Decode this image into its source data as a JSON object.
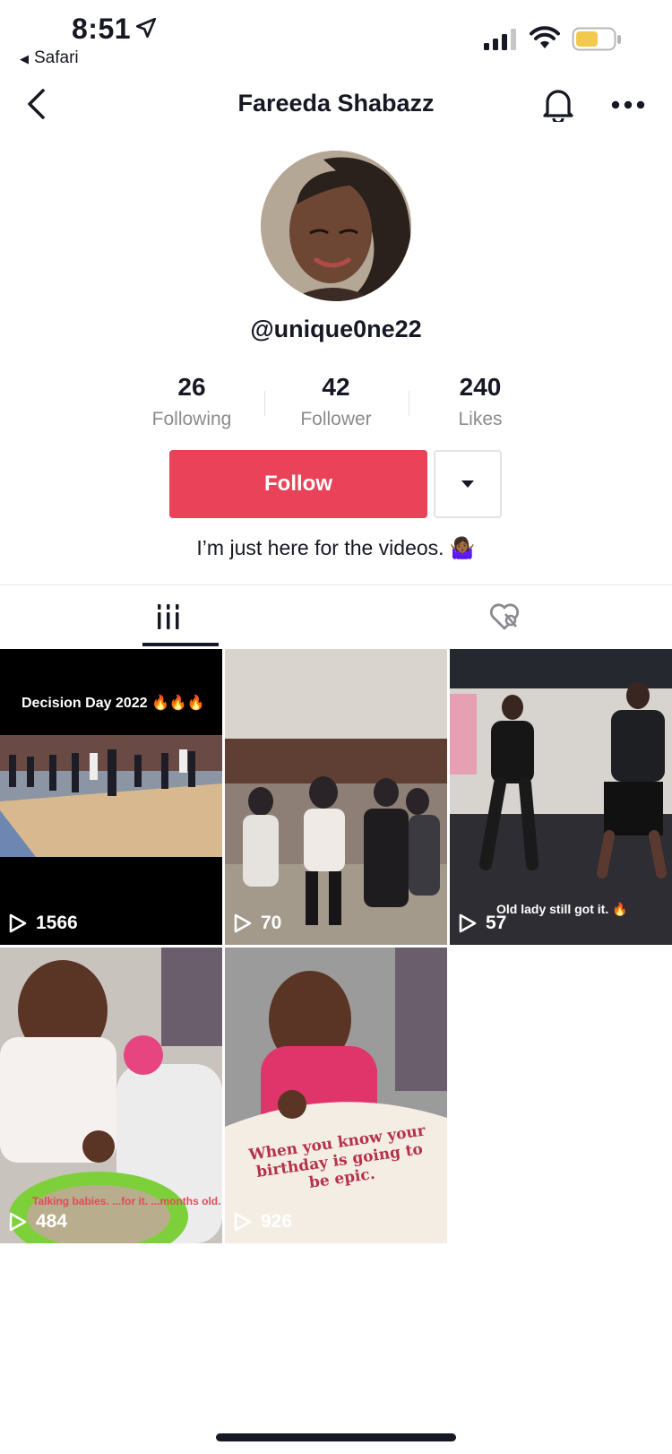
{
  "status_bar": {
    "time": "8:51",
    "back_app": "Safari"
  },
  "nav": {
    "title": "Fareeda Shabazz"
  },
  "profile": {
    "handle": "@unique0ne22",
    "bio": "I’m just here for the videos. 🤷🏾‍♀️"
  },
  "stats": [
    {
      "value": "26",
      "label": "Following"
    },
    {
      "value": "42",
      "label": "Follower"
    },
    {
      "value": "240",
      "label": "Likes"
    }
  ],
  "actions": {
    "follow_label": "Follow"
  },
  "tabs": [
    {
      "name": "videos-grid-tab",
      "icon": "grid-icon"
    },
    {
      "name": "liked-tab",
      "icon": "hidden-heart-icon"
    }
  ],
  "videos": [
    {
      "views": "1566",
      "caption": "Decision Day 2022 🔥🔥🔥"
    },
    {
      "views": "70",
      "caption": ""
    },
    {
      "views": "57",
      "caption": "Old lady still got it. 🔥"
    },
    {
      "views": "484",
      "caption": "Talking babies. ...for it. ...months old."
    },
    {
      "views": "926",
      "caption": "When you know your birthday is going to be epic."
    }
  ],
  "colors": {
    "follow_button": "#ea4359",
    "text": "#161823",
    "muted": "#8a8b91"
  }
}
